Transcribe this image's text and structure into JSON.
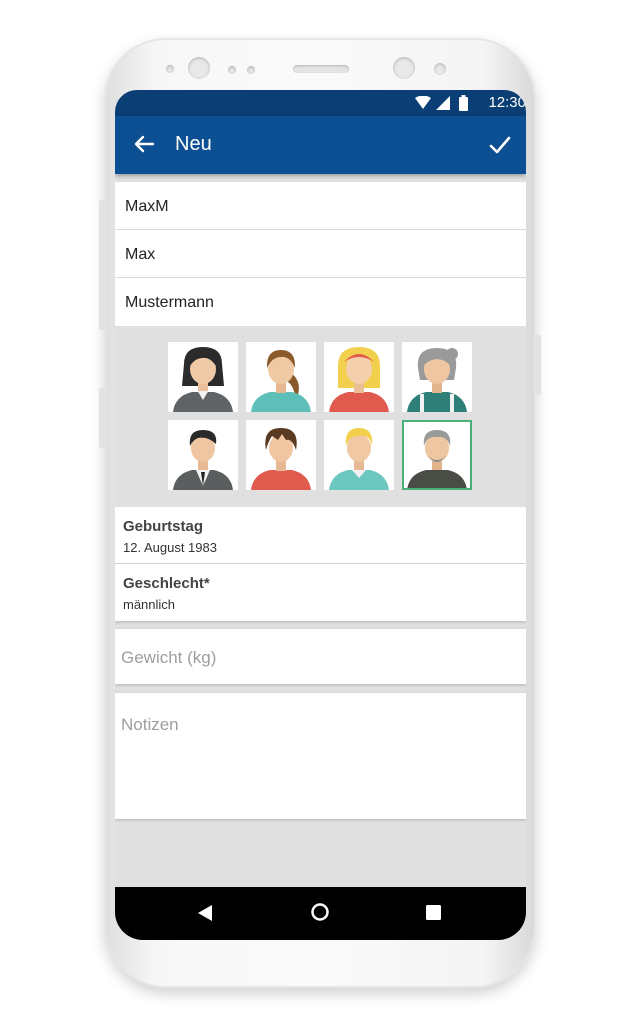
{
  "status_bar": {
    "time": "12:30"
  },
  "app_bar": {
    "title": "Neu",
    "back_icon": "arrow-left-icon",
    "confirm_icon": "check-icon",
    "color": "#0d4f93"
  },
  "form": {
    "username": "MaxM",
    "first_name": "Max",
    "last_name": "Mustermann"
  },
  "avatars": [
    {
      "name": "woman-dark-hair-avatar",
      "selected": false
    },
    {
      "name": "woman-ponytail-avatar",
      "selected": false
    },
    {
      "name": "woman-blonde-headband-avatar",
      "selected": false
    },
    {
      "name": "elderly-woman-avatar",
      "selected": false
    },
    {
      "name": "man-suit-avatar",
      "selected": false
    },
    {
      "name": "man-brown-hair-avatar",
      "selected": false
    },
    {
      "name": "man-blonde-avatar",
      "selected": false
    },
    {
      "name": "elderly-man-beard-avatar",
      "selected": true
    }
  ],
  "birthday": {
    "label": "Geburtstag",
    "value": "12. August 1983"
  },
  "gender": {
    "label": "Geschlecht*",
    "value": "männlich"
  },
  "weight": {
    "placeholder": "Gewicht (kg)"
  },
  "notes": {
    "placeholder": "Notizen"
  },
  "nav": {
    "back_icon": "triangle-back-icon",
    "home_icon": "circle-home-icon",
    "recents_icon": "square-recents-icon"
  }
}
